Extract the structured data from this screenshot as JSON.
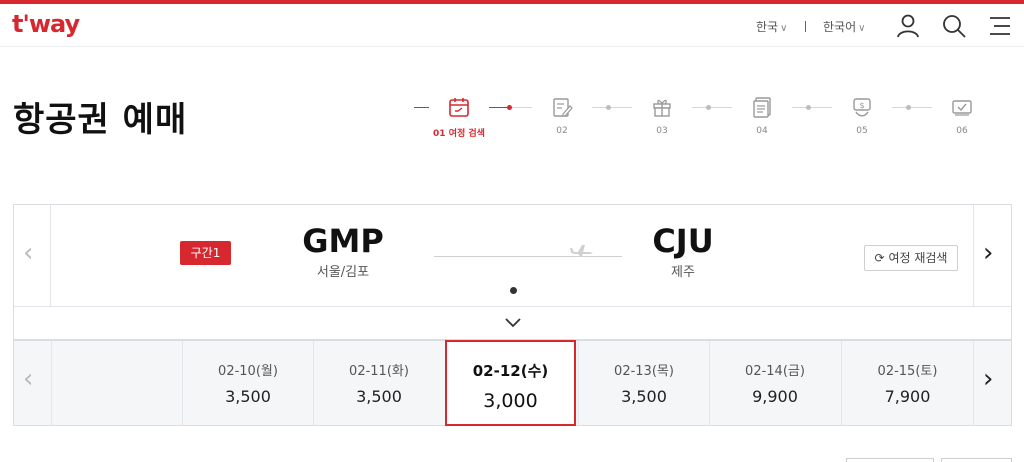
{
  "header": {
    "logo": "t'way",
    "region": "한국",
    "language": "한국어",
    "icons": [
      "user-icon",
      "search-icon",
      "menu-icon"
    ]
  },
  "page": {
    "title": "항공권 예매"
  },
  "steps": [
    {
      "label": "01 여정 검색",
      "icon": "calendar-icon",
      "active": true
    },
    {
      "label": "02",
      "icon": "edit-document-icon",
      "active": false
    },
    {
      "label": "03",
      "icon": "gift-icon",
      "active": false
    },
    {
      "label": "04",
      "icon": "document-list-icon",
      "active": false
    },
    {
      "label": "05",
      "icon": "payment-icon",
      "active": false
    },
    {
      "label": "06",
      "icon": "ticket-check-icon",
      "active": false
    }
  ],
  "route": {
    "segment_label": "구간1",
    "origin_code": "GMP",
    "origin_city": "서울/김포",
    "destination_code": "CJU",
    "destination_city": "제주",
    "research_label": "여정 재검색"
  },
  "dates": [
    {
      "date": "02-10(월)",
      "price": "3,500",
      "selected": false
    },
    {
      "date": "02-11(화)",
      "price": "3,500",
      "selected": false
    },
    {
      "date": "02-12(수)",
      "price": "3,000",
      "selected": true
    },
    {
      "date": "02-13(목)",
      "price": "3,500",
      "selected": false
    },
    {
      "date": "02-14(금)",
      "price": "9,900",
      "selected": false
    },
    {
      "date": "02-15(토)",
      "price": "7,900",
      "selected": false
    }
  ],
  "colors": {
    "brand": "#d8282f",
    "border": "#d9dde3",
    "muted": "#f5f6f8"
  }
}
